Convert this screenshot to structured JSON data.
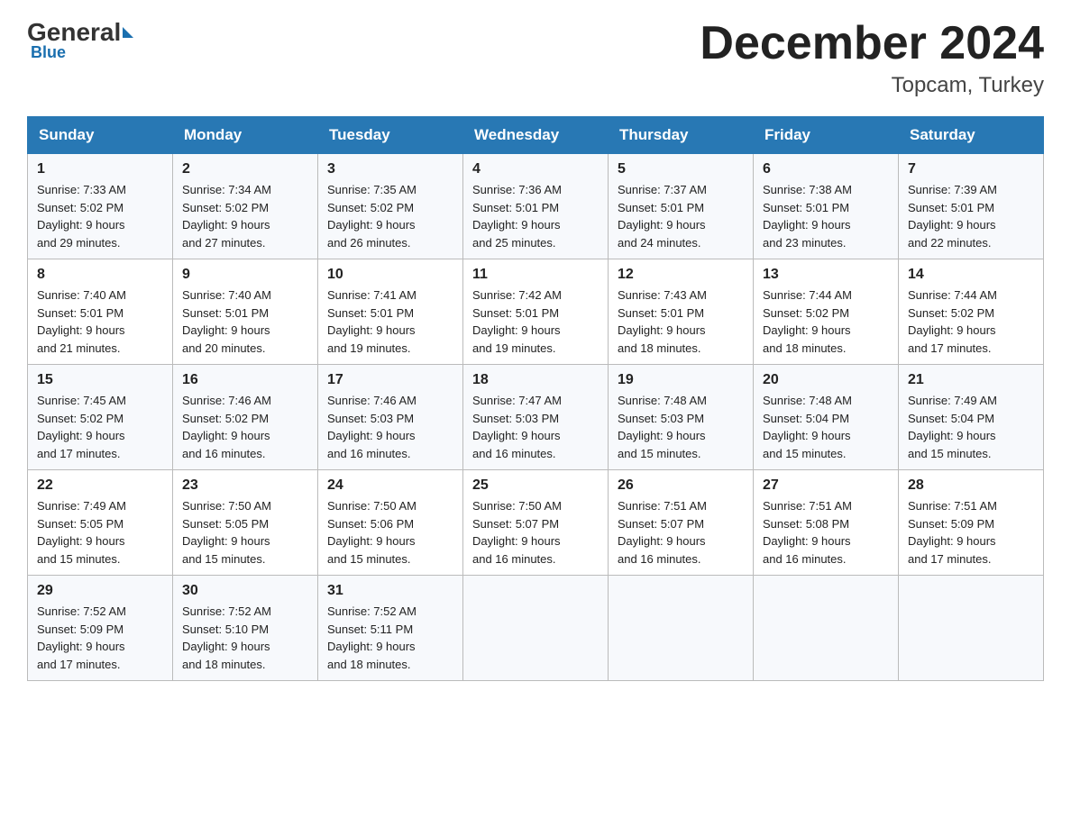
{
  "header": {
    "logo_general": "General",
    "logo_blue": "Blue",
    "month_title": "December 2024",
    "location": "Topcam, Turkey"
  },
  "days_of_week": [
    "Sunday",
    "Monday",
    "Tuesday",
    "Wednesday",
    "Thursday",
    "Friday",
    "Saturday"
  ],
  "weeks": [
    [
      {
        "day": "1",
        "sunrise": "7:33 AM",
        "sunset": "5:02 PM",
        "daylight": "9 hours and 29 minutes."
      },
      {
        "day": "2",
        "sunrise": "7:34 AM",
        "sunset": "5:02 PM",
        "daylight": "9 hours and 27 minutes."
      },
      {
        "day": "3",
        "sunrise": "7:35 AM",
        "sunset": "5:02 PM",
        "daylight": "9 hours and 26 minutes."
      },
      {
        "day": "4",
        "sunrise": "7:36 AM",
        "sunset": "5:01 PM",
        "daylight": "9 hours and 25 minutes."
      },
      {
        "day": "5",
        "sunrise": "7:37 AM",
        "sunset": "5:01 PM",
        "daylight": "9 hours and 24 minutes."
      },
      {
        "day": "6",
        "sunrise": "7:38 AM",
        "sunset": "5:01 PM",
        "daylight": "9 hours and 23 minutes."
      },
      {
        "day": "7",
        "sunrise": "7:39 AM",
        "sunset": "5:01 PM",
        "daylight": "9 hours and 22 minutes."
      }
    ],
    [
      {
        "day": "8",
        "sunrise": "7:40 AM",
        "sunset": "5:01 PM",
        "daylight": "9 hours and 21 minutes."
      },
      {
        "day": "9",
        "sunrise": "7:40 AM",
        "sunset": "5:01 PM",
        "daylight": "9 hours and 20 minutes."
      },
      {
        "day": "10",
        "sunrise": "7:41 AM",
        "sunset": "5:01 PM",
        "daylight": "9 hours and 19 minutes."
      },
      {
        "day": "11",
        "sunrise": "7:42 AM",
        "sunset": "5:01 PM",
        "daylight": "9 hours and 19 minutes."
      },
      {
        "day": "12",
        "sunrise": "7:43 AM",
        "sunset": "5:01 PM",
        "daylight": "9 hours and 18 minutes."
      },
      {
        "day": "13",
        "sunrise": "7:44 AM",
        "sunset": "5:02 PM",
        "daylight": "9 hours and 18 minutes."
      },
      {
        "day": "14",
        "sunrise": "7:44 AM",
        "sunset": "5:02 PM",
        "daylight": "9 hours and 17 minutes."
      }
    ],
    [
      {
        "day": "15",
        "sunrise": "7:45 AM",
        "sunset": "5:02 PM",
        "daylight": "9 hours and 17 minutes."
      },
      {
        "day": "16",
        "sunrise": "7:46 AM",
        "sunset": "5:02 PM",
        "daylight": "9 hours and 16 minutes."
      },
      {
        "day": "17",
        "sunrise": "7:46 AM",
        "sunset": "5:03 PM",
        "daylight": "9 hours and 16 minutes."
      },
      {
        "day": "18",
        "sunrise": "7:47 AM",
        "sunset": "5:03 PM",
        "daylight": "9 hours and 16 minutes."
      },
      {
        "day": "19",
        "sunrise": "7:48 AM",
        "sunset": "5:03 PM",
        "daylight": "9 hours and 15 minutes."
      },
      {
        "day": "20",
        "sunrise": "7:48 AM",
        "sunset": "5:04 PM",
        "daylight": "9 hours and 15 minutes."
      },
      {
        "day": "21",
        "sunrise": "7:49 AM",
        "sunset": "5:04 PM",
        "daylight": "9 hours and 15 minutes."
      }
    ],
    [
      {
        "day": "22",
        "sunrise": "7:49 AM",
        "sunset": "5:05 PM",
        "daylight": "9 hours and 15 minutes."
      },
      {
        "day": "23",
        "sunrise": "7:50 AM",
        "sunset": "5:05 PM",
        "daylight": "9 hours and 15 minutes."
      },
      {
        "day": "24",
        "sunrise": "7:50 AM",
        "sunset": "5:06 PM",
        "daylight": "9 hours and 15 minutes."
      },
      {
        "day": "25",
        "sunrise": "7:50 AM",
        "sunset": "5:07 PM",
        "daylight": "9 hours and 16 minutes."
      },
      {
        "day": "26",
        "sunrise": "7:51 AM",
        "sunset": "5:07 PM",
        "daylight": "9 hours and 16 minutes."
      },
      {
        "day": "27",
        "sunrise": "7:51 AM",
        "sunset": "5:08 PM",
        "daylight": "9 hours and 16 minutes."
      },
      {
        "day": "28",
        "sunrise": "7:51 AM",
        "sunset": "5:09 PM",
        "daylight": "9 hours and 17 minutes."
      }
    ],
    [
      {
        "day": "29",
        "sunrise": "7:52 AM",
        "sunset": "5:09 PM",
        "daylight": "9 hours and 17 minutes."
      },
      {
        "day": "30",
        "sunrise": "7:52 AM",
        "sunset": "5:10 PM",
        "daylight": "9 hours and 18 minutes."
      },
      {
        "day": "31",
        "sunrise": "7:52 AM",
        "sunset": "5:11 PM",
        "daylight": "9 hours and 18 minutes."
      },
      null,
      null,
      null,
      null
    ]
  ]
}
